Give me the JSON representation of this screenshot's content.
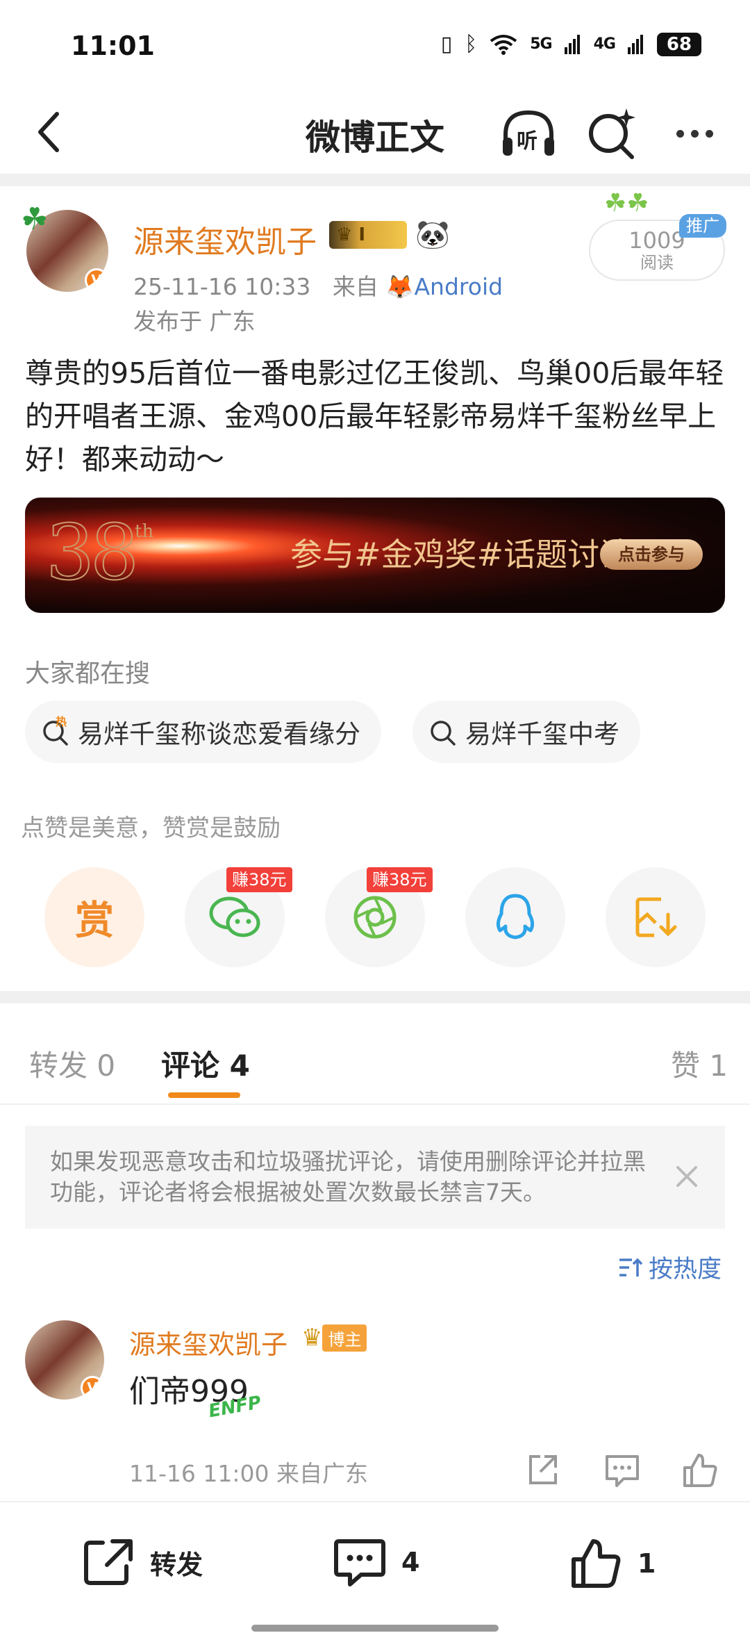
{
  "status_bar": {
    "time": "11:01",
    "signal_5g": "5G",
    "signal_4g": "4G",
    "battery": "68"
  },
  "topbar": {
    "title": "微博正文",
    "listen_label": "听"
  },
  "post": {
    "author": "源来玺欢凯子",
    "level_badge": "I",
    "timestamp": "25-11-16 10:33",
    "source_prefix": "来自",
    "source_client": "Android",
    "location": "发布于 广东",
    "read_count": "1009",
    "read_label": "阅读",
    "promo_tag": "推广",
    "body": "尊贵的95后首位一番电影过亿王俊凯、鸟巢00后最年轻的开唱者王源、金鸡00后最年轻影帝易烊千玺粉丝早上好！都来动动～",
    "banner": {
      "number": "38",
      "suffix": "th",
      "text": "参与#金鸡奖#话题讨论",
      "button": "点击参与"
    }
  },
  "trending": {
    "heading": "大家都在搜",
    "chips": [
      {
        "label": "易烊千玺称谈恋爱看缘分",
        "hot_badge": "热"
      },
      {
        "label": "易烊千玺中考"
      }
    ]
  },
  "share": {
    "tip": "点赞是美意，赞赏是鼓励",
    "reward_label": "赏",
    "earn_tags": [
      "赚38元",
      "赚38元"
    ]
  },
  "tabs": [
    {
      "label": "转发 0"
    },
    {
      "label": "评论 4"
    },
    {
      "label": "赞 1"
    }
  ],
  "notice": {
    "text": "如果发现恶意攻击和垃圾骚扰评论，请使用删除评论并拉黑功能，评论者将会根据被处置次数最长禁言7天。"
  },
  "sort": {
    "label": "按热度"
  },
  "comment": {
    "author": "源来玺欢凯子",
    "badge": "博主",
    "text": "们帝999",
    "sticker": "ENFP",
    "meta": "11-16 11:00 来自广东"
  },
  "bottom_bar": {
    "repost": "转发",
    "comments": "4",
    "likes": "1"
  },
  "colors": {
    "accent_orange": "#f08a1a",
    "link_blue": "#4a7cc7",
    "author_orange": "#e07a1f"
  }
}
